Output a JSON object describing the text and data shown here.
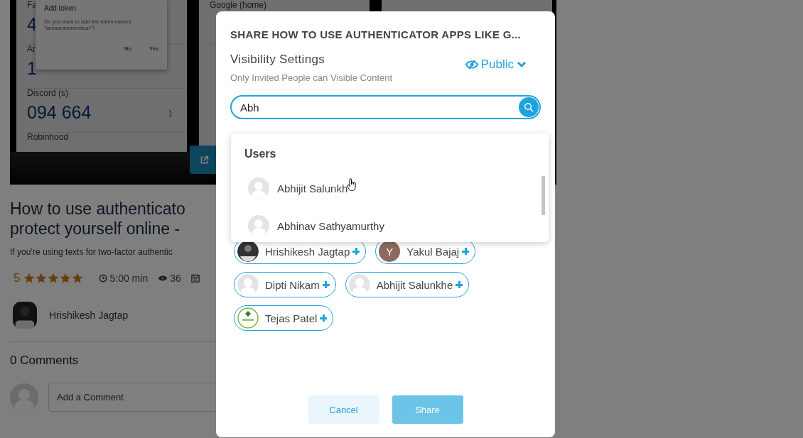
{
  "article": {
    "image": {
      "phones": [
        {
          "rows": [
            {
              "label": "Fa",
              "code": "4"
            },
            {
              "label": "An",
              "code": "1"
            },
            {
              "label": "Discord (s)",
              "code": "094 664"
            },
            {
              "label": "Robinhood",
              "code": ""
            }
          ],
          "dialog": {
            "title": "Add token",
            "message": "Do you want to add the token named \"iamsarammorrison\"?",
            "buttons": [
              "No",
              "Yes"
            ]
          }
        },
        {
          "rows": [
            {
              "label": "Google (home)",
              "code": ""
            }
          ]
        }
      ]
    },
    "title_lines": [
      "How to use authenticato",
      "protect yourself online -"
    ],
    "summary": "If you’re using texts for two-factor authentic",
    "rating": "5",
    "stars": 5,
    "read_time": "5:00 min",
    "views": "36",
    "author": "Hrishikesh Jagtap",
    "comments_heading": "0 Comments",
    "comment_placeholder": "Add a Comment"
  },
  "modal": {
    "title": "SHARE HOW TO USE AUTHENTICATOR APPS LIKE G...",
    "visibility_label": "Visibility Settings",
    "visibility_hint": "Only Invited People can Visible Content",
    "visibility": "Public",
    "search_value": "Abh",
    "dropdown": {
      "heading": "Users",
      "items": [
        {
          "name": "Abhijit Salunkh",
          "hovered": true
        },
        {
          "name": "Abhinav Sathyamurthy",
          "hovered": false
        }
      ]
    },
    "chips": [
      {
        "name": "Hrishikesh Jagtap",
        "kind": "photo"
      },
      {
        "name": "Yakul Bajaj",
        "kind": "letter",
        "letter": "Y"
      },
      {
        "name": "Dipti Nikam",
        "kind": "default"
      },
      {
        "name": "Abhijit Salunkhe",
        "kind": "default"
      },
      {
        "name": "Tejas Patel",
        "kind": "logo"
      }
    ],
    "buttons": [
      {
        "label": "Cancel",
        "kind": "secondary",
        "disabled": false
      },
      {
        "label": "Share",
        "kind": "primary",
        "disabled": true
      }
    ]
  }
}
